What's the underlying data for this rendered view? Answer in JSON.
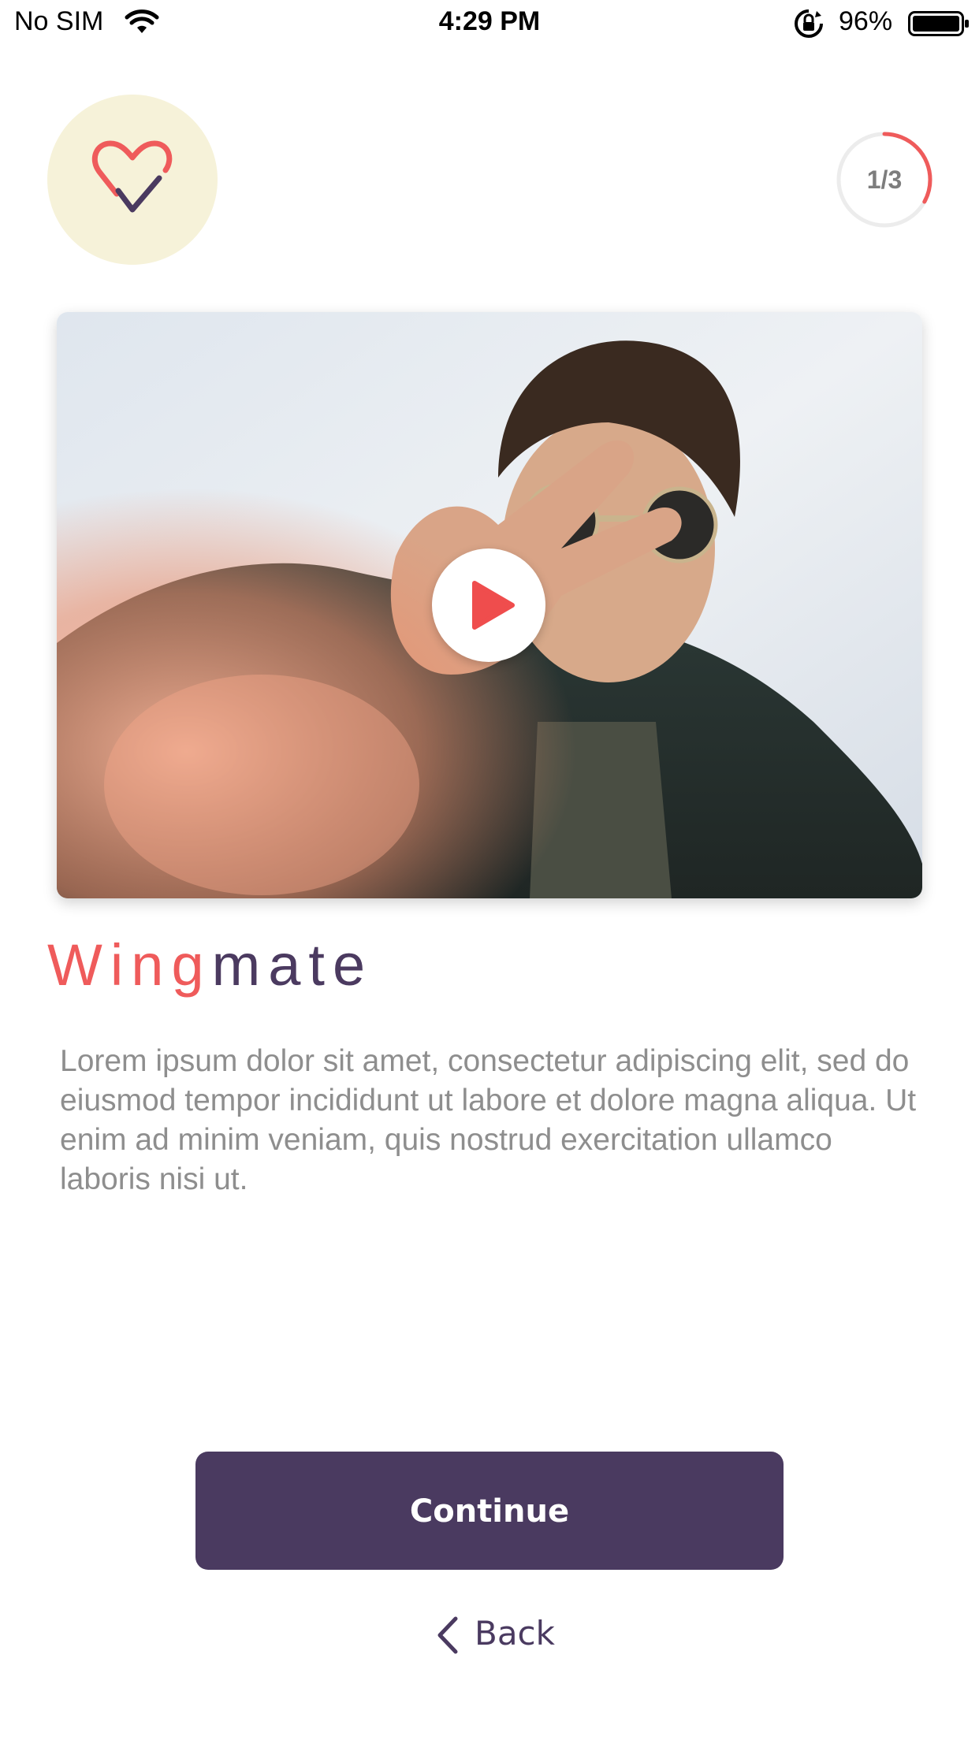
{
  "status_bar": {
    "carrier": "No SIM",
    "time": "4:29 PM",
    "battery_percent": "96%",
    "icons": [
      "wifi-icon",
      "orientation-lock-icon",
      "battery-icon"
    ]
  },
  "header": {
    "logo_icon": "heart-check-icon",
    "progress_label": "1/3",
    "progress_fraction": 0.33
  },
  "media": {
    "play_icon": "play-icon"
  },
  "brand": {
    "part1": "Wing",
    "part2": "mate"
  },
  "description": "Lorem ipsum dolor sit amet, consectetur adipiscing elit, sed do eiusmod tempor incididunt ut labore et dolore magna aliqua. Ut enim ad minim veniam, quis nostrud exercitation ullamco laboris nisi ut.",
  "actions": {
    "continue_label": "Continue",
    "back_label": "Back"
  },
  "colors": {
    "accent": "#ef5b5b",
    "primary": "#4a3a60",
    "logo_bg": "#f6f2d9",
    "text_muted": "#8e8e8e"
  }
}
